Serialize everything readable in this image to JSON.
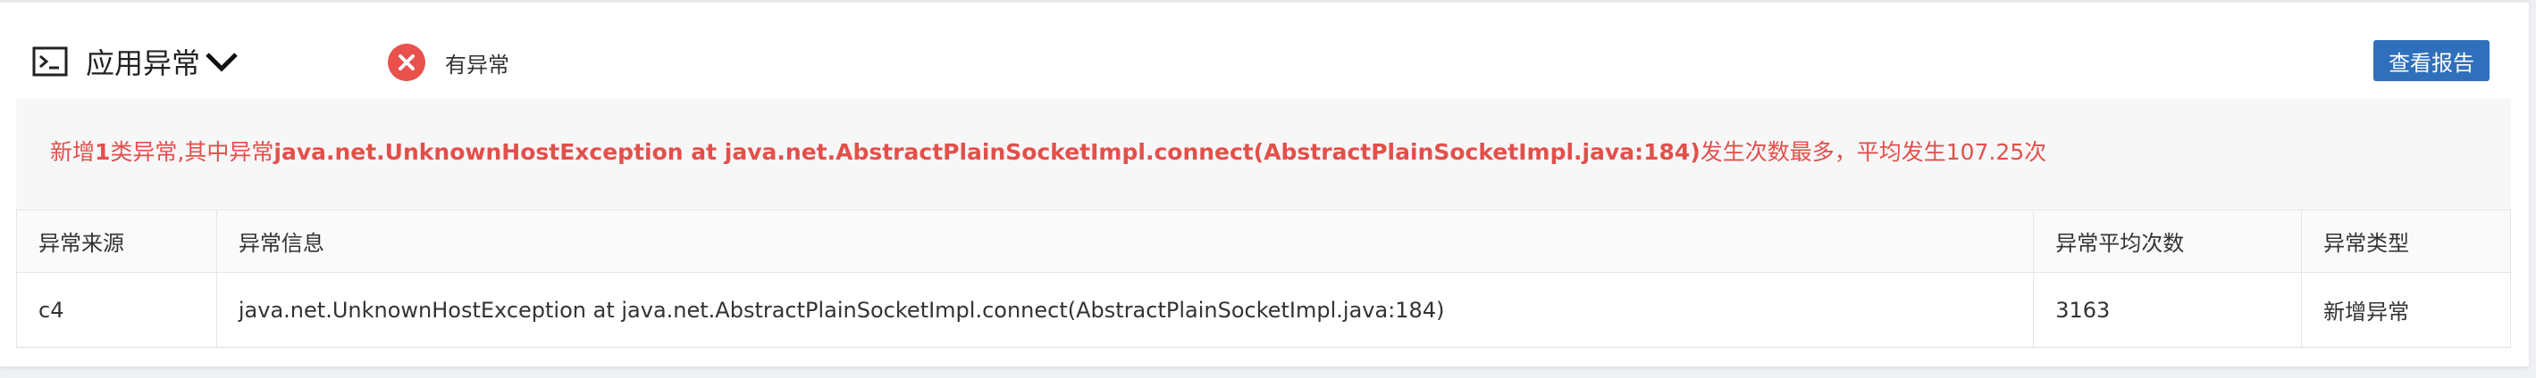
{
  "header": {
    "title": "应用异常",
    "status_text": "有异常",
    "report_button": "查看报告"
  },
  "summary": {
    "prefix": "新增",
    "count": "1",
    "middle": "类异常,其中异常",
    "exception": "java.net.UnknownHostException at java.net.AbstractPlainSocketImpl.connect(AbstractPlainSocketImpl.java:184)",
    "suffix": "发生次数最多，平均发生107.25次"
  },
  "table": {
    "columns": [
      "异常来源",
      "异常信息",
      "异常平均次数",
      "异常类型"
    ],
    "rows": [
      {
        "source": "c4",
        "info": "java.net.UnknownHostException at java.net.AbstractPlainSocketImpl.connect(AbstractPlainSocketImpl.java:184)",
        "avg_count": "3163",
        "type": "新增异常"
      }
    ]
  },
  "icons": {
    "title_icon": "terminal-icon",
    "toggle_icon": "chevron-down-icon",
    "status_icon": "error-circle-icon"
  },
  "colors": {
    "accent_button": "#2f6fbc",
    "error": "#e8514c",
    "summary_text": "#e2504b"
  }
}
